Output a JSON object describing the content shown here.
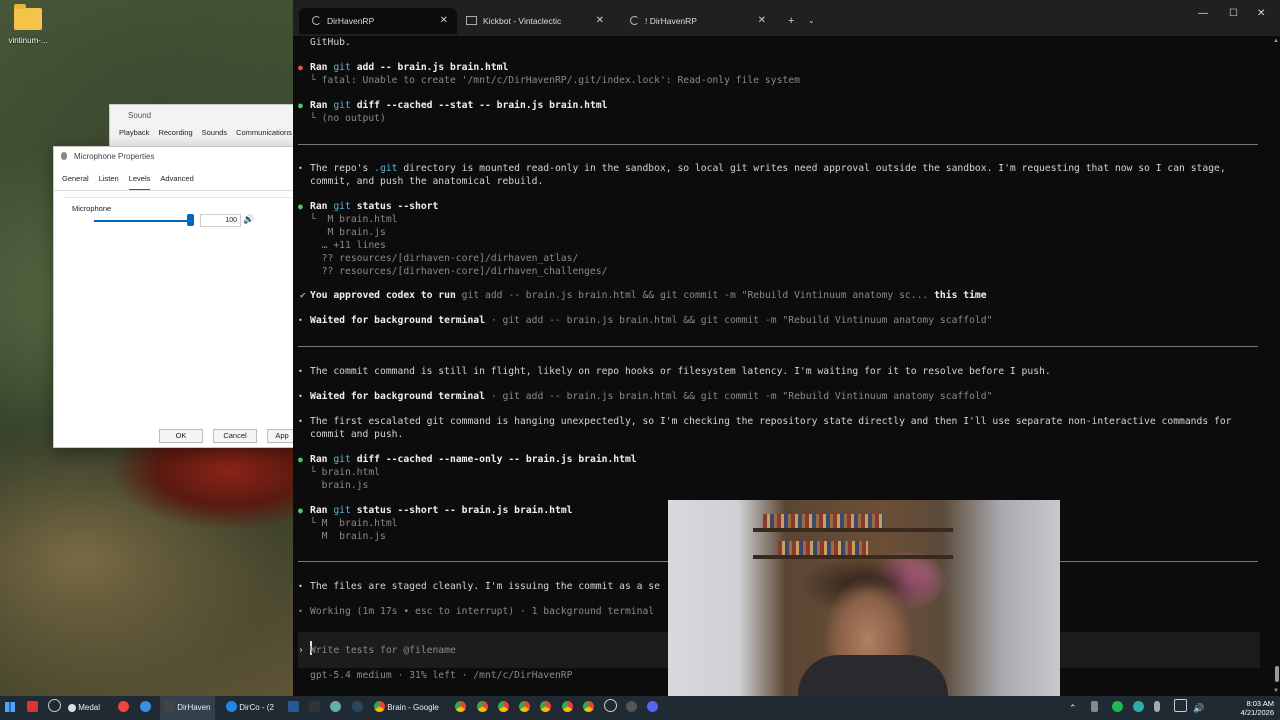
{
  "desktop": {
    "icon_label": "vintinum-..."
  },
  "sound_window": {
    "title": "Sound",
    "tabs": [
      "Playback",
      "Recording",
      "Sounds",
      "Communications"
    ]
  },
  "mic_window": {
    "title": "Microphone Properties",
    "tabs": [
      "General",
      "Listen",
      "Levels",
      "Advanced"
    ],
    "active_tab": "Levels",
    "section_label": "Microphone",
    "level_value": "100",
    "level_fraction": 1.0,
    "ok_label": "OK",
    "cancel_label": "Cancel",
    "apply_label": "App"
  },
  "terminal": {
    "tabs": [
      {
        "title": "DirHavenRP",
        "active": true
      },
      {
        "title": "Kickbot - Vintaclectic",
        "active": false
      },
      {
        "title": "! DirHavenRP",
        "active": false
      }
    ],
    "lines": {
      "l1": "GitHub.",
      "l2_ran": "Ran",
      "l2_git": "git",
      "l2_cmd": "add -- brain.js brain.html",
      "l3": "└ fatal: Unable to create '/mnt/c/DirHavenRP/.git/index.lock': Read-only file system",
      "l4_ran": "Ran",
      "l4_git": "git",
      "l4_cmd": "diff --cached --stat -- brain.js brain.html",
      "l5": "└ (no output)",
      "l6a": "The repo's ",
      "l6b": ".git",
      "l6c": " directory is mounted read-only in the sandbox, so local git writes need approval outside the sandbox. I'm requesting that now so I can stage,",
      "l7": "commit, and push the anatomical rebuild.",
      "l8_ran": "Ran",
      "l8_git": "git",
      "l8_cmd": "status --short",
      "l9": "└  M brain.html",
      "l10": "   M brain.js",
      "l11": "  … +11 lines",
      "l12": "  ?? resources/[dirhaven-core]/dirhaven_atlas/",
      "l13": "  ?? resources/[dirhaven-core]/dirhaven_challenges/",
      "l14_check": "✔",
      "l14a": "You approved codex to run ",
      "l14b": "git add -- brain.js brain.html && git commit -m \"Rebuild Vintinuum anatomy sc...",
      "l14c": " this time",
      "l15a": "Waited for background terminal",
      "l15b": " · git add -- brain.js brain.html && git commit -m \"Rebuild Vintinuum anatomy scaffold\"",
      "l16": "The commit command is still in flight, likely on repo hooks or filesystem latency. I'm waiting for it to resolve before I push.",
      "l17a": "Waited for background terminal",
      "l17b": " · git add -- brain.js brain.html && git commit -m \"Rebuild Vintinuum anatomy scaffold\"",
      "l18": "The first escalated git command is hanging unexpectedly, so I'm checking the repository state directly and then I'll use separate non-interactive commands for",
      "l19": "commit and push.",
      "l20_ran": "Ran",
      "l20_git": "git",
      "l20_cmd": "diff --cached --name-only -- brain.js brain.html",
      "l21": "└ brain.html",
      "l22": "  brain.js",
      "l23_ran": "Ran",
      "l23_git": "git",
      "l23_cmd": "status --short -- brain.js brain.html",
      "l24": "└ M  brain.html",
      "l25": "  M  brain.js",
      "l26": "The files are staged cleanly. I'm issuing the commit as a se",
      "l27": "Working (1m 17s • esc to interrupt) · 1 background terminal",
      "prompt_placeholder": "Write tests for @filename",
      "status_bar": "gpt-5.4 medium · 31% left · /mnt/c/DirHavenRP"
    }
  },
  "taskbar": {
    "items": [
      "Medal",
      "DirHaven",
      "DirCo - (2",
      "Brain - Google"
    ],
    "time": "8:03 AM",
    "date": "4/21/2026"
  },
  "colors": {
    "terminal_bg": "#0c0c0c",
    "cyan": "#5fb3d4",
    "error_bullet": "#e05555",
    "ok_bullet": "#4ec96a",
    "accent": "#0067c0"
  }
}
